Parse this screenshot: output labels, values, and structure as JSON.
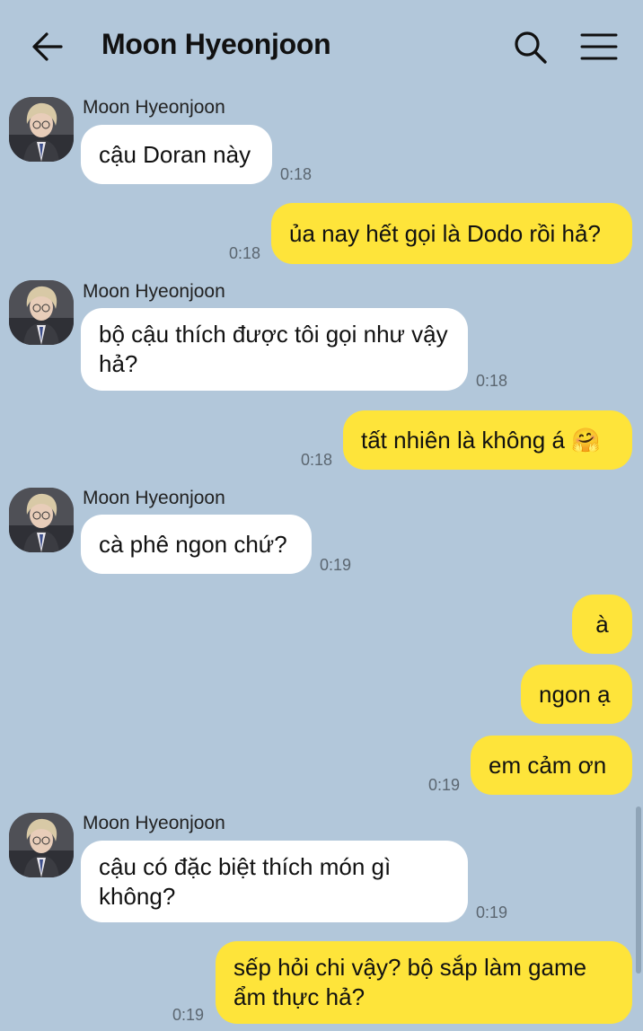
{
  "header": {
    "title": "Moon Hyeonjoon",
    "back_icon": "arrow-left-icon",
    "search_icon": "search-icon",
    "menu_icon": "hamburger-menu-icon"
  },
  "colors": {
    "background": "#b2c7da",
    "incoming_bubble": "#ffffff",
    "outgoing_bubble": "#fee43a"
  },
  "messages": [
    {
      "sender": "Moon Hyeonjoon",
      "direction": "in",
      "text": "cậu Doran này",
      "time": "0:18"
    },
    {
      "direction": "out",
      "text": "ủa nay hết gọi là Dodo rồi hả?",
      "time": "0:18"
    },
    {
      "sender": "Moon Hyeonjoon",
      "direction": "in",
      "text": "bộ cậu thích được tôi gọi như vậy hả?",
      "time": "0:18"
    },
    {
      "direction": "out",
      "text": "tất nhiên là không á 🤗",
      "time": "0:18"
    },
    {
      "sender": "Moon Hyeonjoon",
      "direction": "in",
      "text": "cà phê ngon chứ?",
      "time": "0:19"
    },
    {
      "direction": "out",
      "text": "à"
    },
    {
      "direction": "out",
      "text": "ngon ạ"
    },
    {
      "direction": "out",
      "text": "em cảm ơn",
      "time": "0:19"
    },
    {
      "sender": "Moon Hyeonjoon",
      "direction": "in",
      "text": "cậu có đặc biệt thích món gì không?",
      "time": "0:19"
    },
    {
      "direction": "out",
      "text": "sếp hỏi chi vậy? bộ sắp làm game ẩm thực hả?",
      "time": "0:19"
    }
  ]
}
